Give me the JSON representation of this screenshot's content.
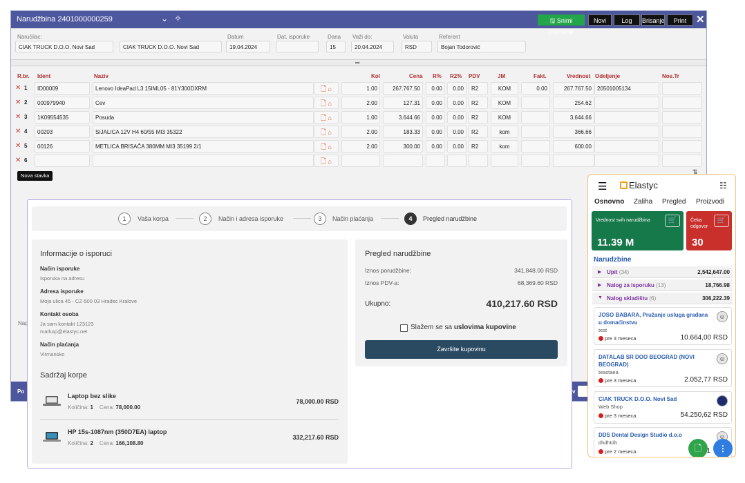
{
  "order": {
    "title": "Narudžbina 2401000000259",
    "toolbar": {
      "save": "Snimi promene",
      "new": "Novi",
      "log": "Log",
      "delete": "Brisanje",
      "print": "Print"
    },
    "header": {
      "customer_label": "Naručilac:",
      "customer_code": "CIAK TRUCK D.O.O. Novi Sad",
      "customer_name": "CIAK TRUCK D.O.O. Novi Sad",
      "date_label": "Datum",
      "date": "19.04.2024",
      "delivery_label": "Dat. isporuke",
      "delivery": "",
      "days_label": "Dana",
      "days": "15",
      "valid_label": "Važi do:",
      "valid": "20.04.2024",
      "currency_label": "Valuta",
      "currency": "RSD",
      "referent_label": "Referent",
      "referent": "Bojan Todorović"
    },
    "columns": [
      "R.br.",
      "Ident",
      "Naziv",
      "Kol",
      "Cena",
      "R%",
      "R2%",
      "PDV",
      "JM",
      "Fakt.",
      "Vrednost",
      "Odeljenje",
      "Nos.Tr"
    ],
    "rows": [
      {
        "no": "1",
        "ident": "ID00009",
        "name": "Lenovo IdeaPad L3 15IML05 - 81Y300DXRM",
        "qty": "1.00",
        "price": "267.767.50",
        "r": "0.00",
        "r2": "0.00",
        "pdv": "R2",
        "jm": "KOM",
        "fakt": "0.00",
        "value": "267.767.50",
        "dept": "20501005134"
      },
      {
        "no": "2",
        "ident": "000979940",
        "name": "Cev",
        "qty": "2.00",
        "price": "127.31",
        "r": "0.00",
        "r2": "0.00",
        "pdv": "R2",
        "jm": "KOM",
        "fakt": "",
        "value": "254.62",
        "dept": ""
      },
      {
        "no": "3",
        "ident": "1K09554535",
        "name": "Posuda",
        "qty": "1.00",
        "price": "3.644.66",
        "r": "0.00",
        "r2": "0.00",
        "pdv": "R2",
        "jm": "KOM",
        "fakt": "",
        "value": "3,644.66",
        "dept": ""
      },
      {
        "no": "4",
        "ident": "00203",
        "name": "SIJALICA 12V H4 60/55 MI3 35322",
        "qty": "2.00",
        "price": "183.33",
        "r": "0.00",
        "r2": "0.00",
        "pdv": "R2",
        "jm": "kom",
        "fakt": "",
        "value": "366.66",
        "dept": ""
      },
      {
        "no": "5",
        "ident": "00126",
        "name": "METLICA BRISAČA 380MM MI3 35199 2/1",
        "qty": "2.00",
        "price": "300.00",
        "r": "0.00",
        "r2": "0.00",
        "pdv": "R2",
        "jm": "kom",
        "fakt": "",
        "value": "600.00",
        "dept": ""
      },
      {
        "no": "6",
        "ident": "",
        "name": "",
        "qty": "",
        "price": "",
        "r": "",
        "r2": "",
        "pdv": "",
        "jm": "",
        "fakt": "",
        "value": "",
        "dept": ""
      }
    ],
    "add_item": "Nova stavka",
    "notes_label": "Nap",
    "footer_left": "Po",
    "footer_right": "v"
  },
  "checkout": {
    "steps": [
      {
        "num": "1",
        "label": "Vaša korpa"
      },
      {
        "num": "2",
        "label": "Način i adresa isporuke"
      },
      {
        "num": "3",
        "label": "Način plaćanja"
      },
      {
        "num": "4",
        "label": "Pregled narudžbine"
      }
    ],
    "info": {
      "title": "Informacije o isporuci",
      "delivery_method_label": "Način isporuke",
      "delivery_method": "Isporuka na adresu",
      "address_label": "Adresa isporuke",
      "address": "Moja ulica 45 - CZ-500 03 Hradec Kralove",
      "contact_label": "Kontakt osoba",
      "contact_name": "Ja sam kontakt 123123",
      "contact_email": "markop@elastyc.net",
      "payment_label": "Način plaćanja",
      "payment": "Virmansko",
      "cart_title": "Sadržaj korpe"
    },
    "products": [
      {
        "name": "Laptop bez slike",
        "qty_label": "Količina:",
        "qty": "1",
        "price_label": "Cena:",
        "price": "78,000.00",
        "total": "78,000.00 RSD"
      },
      {
        "name": "HP 15s-1087nm (350D7EA) laptop",
        "qty_label": "Količina:",
        "qty": "2",
        "price_label": "Cena:",
        "price": "166,108.80",
        "total": "332,217.60 RSD"
      }
    ],
    "summary": {
      "title": "Pregled narudžbine",
      "amount_label": "Iznos porudžbine:",
      "amount": "341,848.00 RSD",
      "vat_label": "Iznos PDV-a:",
      "vat": "68,369.60 RSD",
      "total_label": "Ukupno:",
      "total": "410,217.60 RSD",
      "agree_prefix": "Slažem se sa ",
      "agree_link": "uslovima kupovine",
      "finish": "Završite kupovinu"
    }
  },
  "mobile": {
    "logo": "Elastyc",
    "tabs": [
      "Osnovno",
      "Zaliha",
      "Pregled",
      "Proizvodi"
    ],
    "card_total_label": "Vrednost svih narudžbina",
    "card_total_value": "11.39 M",
    "card_wait_label": "Čeka odgovor",
    "card_wait_value": "30",
    "section": "Narudzbine",
    "groups": [
      {
        "label": "Upit",
        "count": "(34)",
        "value": "2,542,647.00"
      },
      {
        "label": "Nalog za isporuku",
        "count": "(13)",
        "value": "18,766.98"
      },
      {
        "label": "Nalog skladištu",
        "count": "(6)",
        "value": "306,222.39"
      }
    ],
    "orders": [
      {
        "title": "JOSO BABARA, Pružanje usluga građana u domaćinstvu",
        "sub": "test",
        "time": "pre 3 meseca",
        "amount": "10.664,00 RSD"
      },
      {
        "title": "DATALAB SR DOO BEOGRAD (NOVI BEOGRAD)",
        "sub": "teastaea",
        "time": "pre 3 meseca",
        "amount": "2.052,77 RSD"
      },
      {
        "title": "CIAK TRUCK D.O.O. Novi Sad",
        "sub": "Web Shop",
        "time": "pre 3 meseca",
        "amount": "54.250,62 RSD"
      },
      {
        "title": "DDS Dental Design Studio d.o.o",
        "sub": "dhdhtdh",
        "time": "pre 2 meseca",
        "amount": "1"
      }
    ],
    "colors": {
      "green": "#16794a",
      "red": "#c9302c",
      "accent": "#2a5db0",
      "purple": "#7a2fa0"
    }
  }
}
